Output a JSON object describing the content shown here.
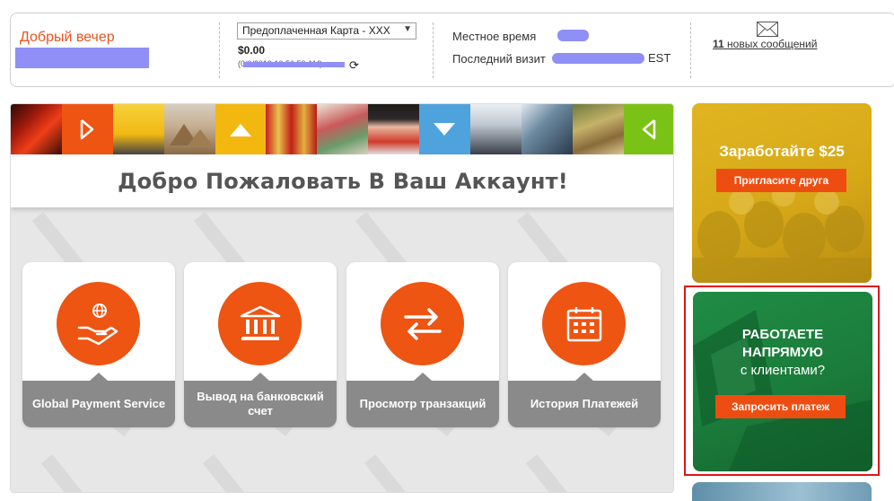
{
  "header": {
    "greeting": "Добрый вечер",
    "account_select": "Предоплаченная Карта - XXX",
    "balance": "$0.00",
    "balance_time": "(0/0/2019 10:50:50 AM)",
    "local_time_label": "Местное время",
    "last_visit_label": "Последний визит",
    "last_visit_tz": "EST",
    "messages_count": "11",
    "messages_text": "новых сообщений"
  },
  "main": {
    "welcome_title": "Добро Пожаловать В Ваш Аккаунт!",
    "actions": [
      {
        "label": "Global Payment Service",
        "icon": "hand-globe-icon"
      },
      {
        "label": "Вывод на банковский счет",
        "icon": "bank-icon"
      },
      {
        "label": "Просмотр транзакций",
        "icon": "transfer-arrows-icon"
      },
      {
        "label": "История Платежей",
        "icon": "calendar-icon"
      }
    ]
  },
  "promos": {
    "referral_title": "Заработайте $25",
    "referral_button": "Пригласите друга",
    "direct_line1": "РАБОТАЕТЕ",
    "direct_line2": "НАПРЯМУЮ",
    "direct_line3": "с клиентами?",
    "direct_button": "Запросить платеж"
  },
  "colors": {
    "accent": "#ee5412",
    "greeting": "#e8541e",
    "promo_yellow": "#d6a818",
    "promo_green": "#1b7c3b",
    "highlight": "#e01515",
    "card_footer": "#8a8a8a"
  }
}
